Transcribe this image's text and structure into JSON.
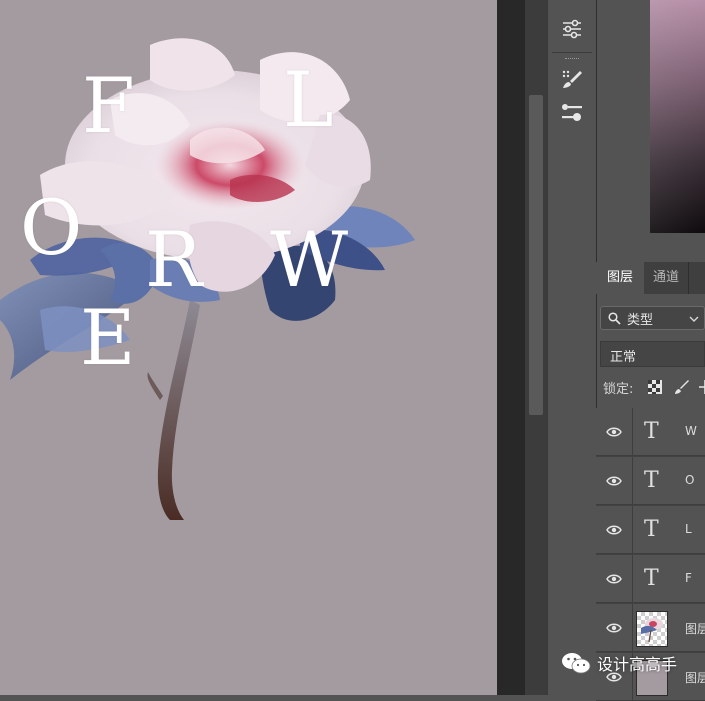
{
  "canvas": {
    "background": "#a49ba0",
    "letters": [
      "F",
      "L",
      "O",
      "R",
      "W",
      "E"
    ]
  },
  "toolstrip": {
    "tools": [
      "adjustments-sliders-icon",
      "brush-settings-icon",
      "clone-source-icon"
    ]
  },
  "panel": {
    "tabs": [
      {
        "label": "图层",
        "active": true
      },
      {
        "label": "通道",
        "active": false
      }
    ],
    "filter": {
      "label": "类型"
    },
    "blend_mode": {
      "label": "正常"
    },
    "lock": {
      "label": "锁定:"
    },
    "layers": [
      {
        "type": "text",
        "glyph": "T",
        "name": "W"
      },
      {
        "type": "text",
        "glyph": "T",
        "name": "O"
      },
      {
        "type": "text",
        "glyph": "T",
        "name": "L"
      },
      {
        "type": "text",
        "glyph": "T",
        "name": "F"
      },
      {
        "type": "pixel",
        "name": "图层"
      },
      {
        "type": "pixel",
        "name": "图层"
      }
    ]
  },
  "watermark": {
    "text": "设计高高手"
  }
}
